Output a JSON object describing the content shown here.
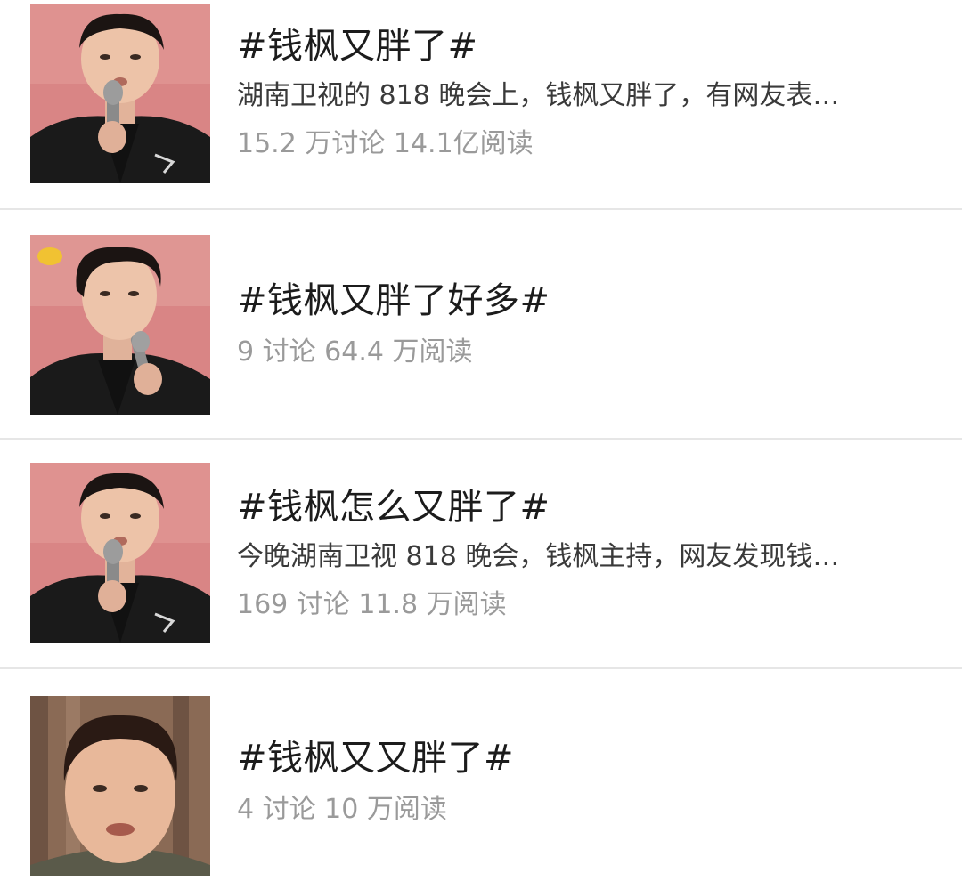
{
  "topics": [
    {
      "title": "#钱枫又胖了#",
      "description": "湖南卫视的 818 晚会上，钱枫又胖了，有网友表…",
      "stats": "15.2 万讨论 14.1亿阅读",
      "thumbnail": "stage-host-microphone-photo"
    },
    {
      "title": "#钱枫又胖了好多#",
      "description": "",
      "stats": "9 讨论 64.4 万阅读",
      "thumbnail": "stage-host-side-glance-photo"
    },
    {
      "title": "#钱枫怎么又胖了#",
      "description": "今晚湖南卫视 818 晚会，钱枫主持，网友发现钱…",
      "stats": "169 讨论 11.8 万阅读",
      "thumbnail": "stage-host-microphone-photo"
    },
    {
      "title": "#钱枫又又胖了#",
      "description": "",
      "stats": "4 讨论 10 万阅读",
      "thumbnail": "selfie-portrait-photo"
    }
  ],
  "colors": {
    "title": "#1c1c1c",
    "description": "#3a3a3a",
    "stats": "#9a9a9a",
    "divider": "#e6e6e6",
    "stage_background": "#d98585",
    "jacket": "#1a1a1a"
  }
}
